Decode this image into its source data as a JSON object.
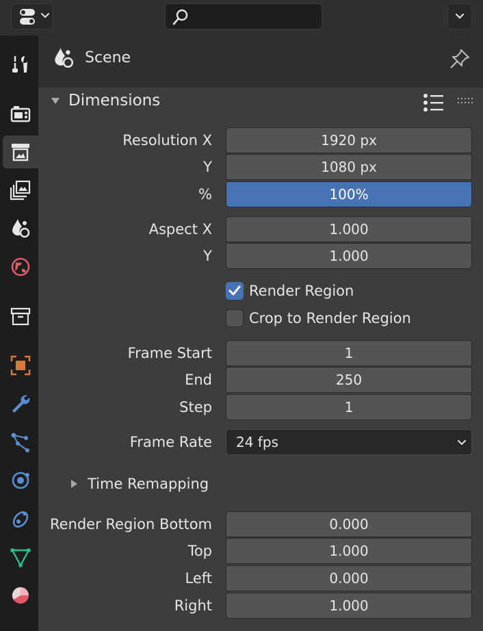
{
  "header": {
    "search": {
      "value": "",
      "placeholder": ""
    }
  },
  "sidebar": {
    "tabs": [
      {
        "name": "tool-tab",
        "icon": "tool-icon",
        "active": false
      },
      {
        "name": "render-tab",
        "icon": "render-icon",
        "active": false
      },
      {
        "name": "output-tab",
        "icon": "output-icon",
        "active": true
      },
      {
        "name": "view-layer-tab",
        "icon": "view-layer-icon",
        "active": false
      },
      {
        "name": "scene-tab",
        "icon": "scene-icon",
        "active": false
      },
      {
        "name": "world-tab",
        "icon": "world-icon",
        "active": false
      },
      {
        "name": "collection-tab",
        "icon": "collection-icon",
        "active": false
      },
      {
        "name": "object-tab",
        "icon": "object-icon",
        "active": false
      },
      {
        "name": "modifiers-tab",
        "icon": "wrench-icon",
        "active": false
      },
      {
        "name": "particles-tab",
        "icon": "particles-icon",
        "active": false
      },
      {
        "name": "physics-tab",
        "icon": "physics-icon",
        "active": false
      },
      {
        "name": "constraints-tab",
        "icon": "constraints-icon",
        "active": false
      },
      {
        "name": "data-tab",
        "icon": "mesh-data-icon",
        "active": false
      },
      {
        "name": "material-tab",
        "icon": "material-icon",
        "active": false
      }
    ],
    "colors": {
      "accent_orange": "#d67a3a",
      "accent_blue": "#5b8fd1",
      "accent_red": "#e05a6a",
      "accent_green": "#2cc08a"
    }
  },
  "context": {
    "scene_label": "Scene"
  },
  "panel": {
    "title": "Dimensions",
    "resolution_x_label": "Resolution X",
    "resolution_x": "1920 px",
    "resolution_y_label": "Y",
    "resolution_y": "1080 px",
    "resolution_pct_label": "%",
    "resolution_pct": "100%",
    "aspect_x_label": "Aspect X",
    "aspect_x": "1.000",
    "aspect_y_label": "Y",
    "aspect_y": "1.000",
    "render_region_label": "Render Region",
    "render_region_checked": true,
    "crop_label": "Crop to Render Region",
    "crop_checked": false,
    "frame_start_label": "Frame Start",
    "frame_start": "1",
    "frame_end_label": "End",
    "frame_end": "250",
    "frame_step_label": "Step",
    "frame_step": "1",
    "frame_rate_label": "Frame Rate",
    "frame_rate": "24 fps",
    "time_remapping_label": "Time Remapping",
    "rr_bottom_label": "Render Region Bottom",
    "rr_bottom": "0.000",
    "rr_top_label": "Top",
    "rr_top": "1.000",
    "rr_left_label": "Left",
    "rr_left": "0.000",
    "rr_right_label": "Right",
    "rr_right": "1.000",
    "accent_color": "#4772b3"
  }
}
